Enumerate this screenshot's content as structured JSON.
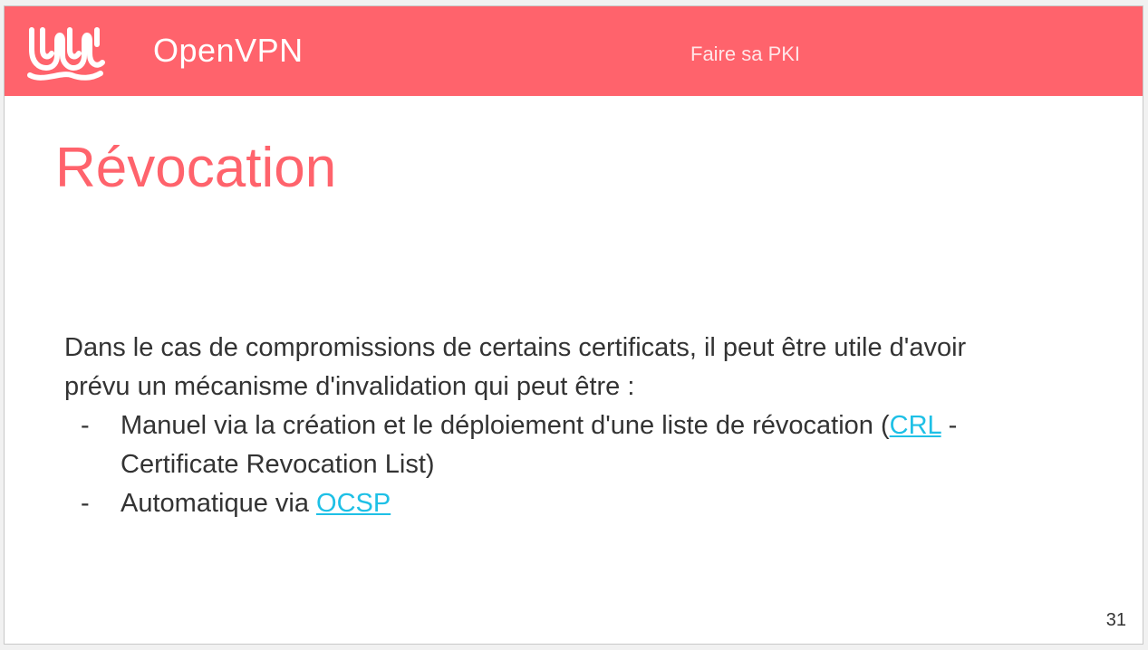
{
  "header": {
    "brand": "OpenVPN",
    "section": "Faire sa PKI",
    "background_color": "#ff636c",
    "logo_icon": "openvpn-logo-icon"
  },
  "slide": {
    "title": "Révocation",
    "intro_line1": "Dans le cas de compromissions de certains certificats, il peut être utile d'avoir",
    "intro_line2": "prévu un mécanisme d'invalidation qui peut être :",
    "items": [
      {
        "bullet": "-",
        "text_before_link": "Manuel via la création et le déploiement d'une liste de révocation (",
        "link_text": "CRL",
        "text_after_link": " -",
        "continuation": "Certificate Revocation List)"
      },
      {
        "bullet": "-",
        "text_before_link": "Automatique via ",
        "link_text": "OCSP"
      }
    ],
    "page_number": "31",
    "title_color": "#ff636c",
    "link_color": "#1ec0e6"
  }
}
